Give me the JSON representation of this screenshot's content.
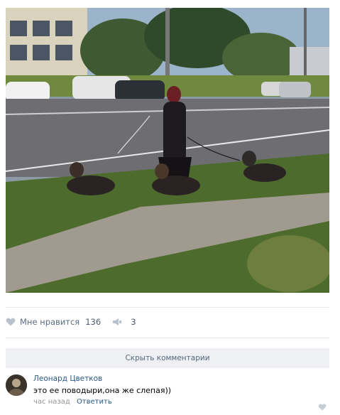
{
  "post": {
    "likes_label": "Мне нравится",
    "likes_count": "136",
    "reposts_count": "3",
    "like_icon": "heart-icon",
    "repost_icon": "megaphone-icon"
  },
  "comments_section": {
    "hide_label": "Скрыть комментарии"
  },
  "comment": {
    "author": "Леонард Цветков",
    "text": "это ее поводыри,она же слепая))",
    "time": "час назад",
    "reply_label": "Ответить",
    "like_icon": "heart-icon"
  },
  "colors": {
    "link": "#2a5885",
    "muted": "#939393",
    "button_bg": "#eef0f3"
  }
}
